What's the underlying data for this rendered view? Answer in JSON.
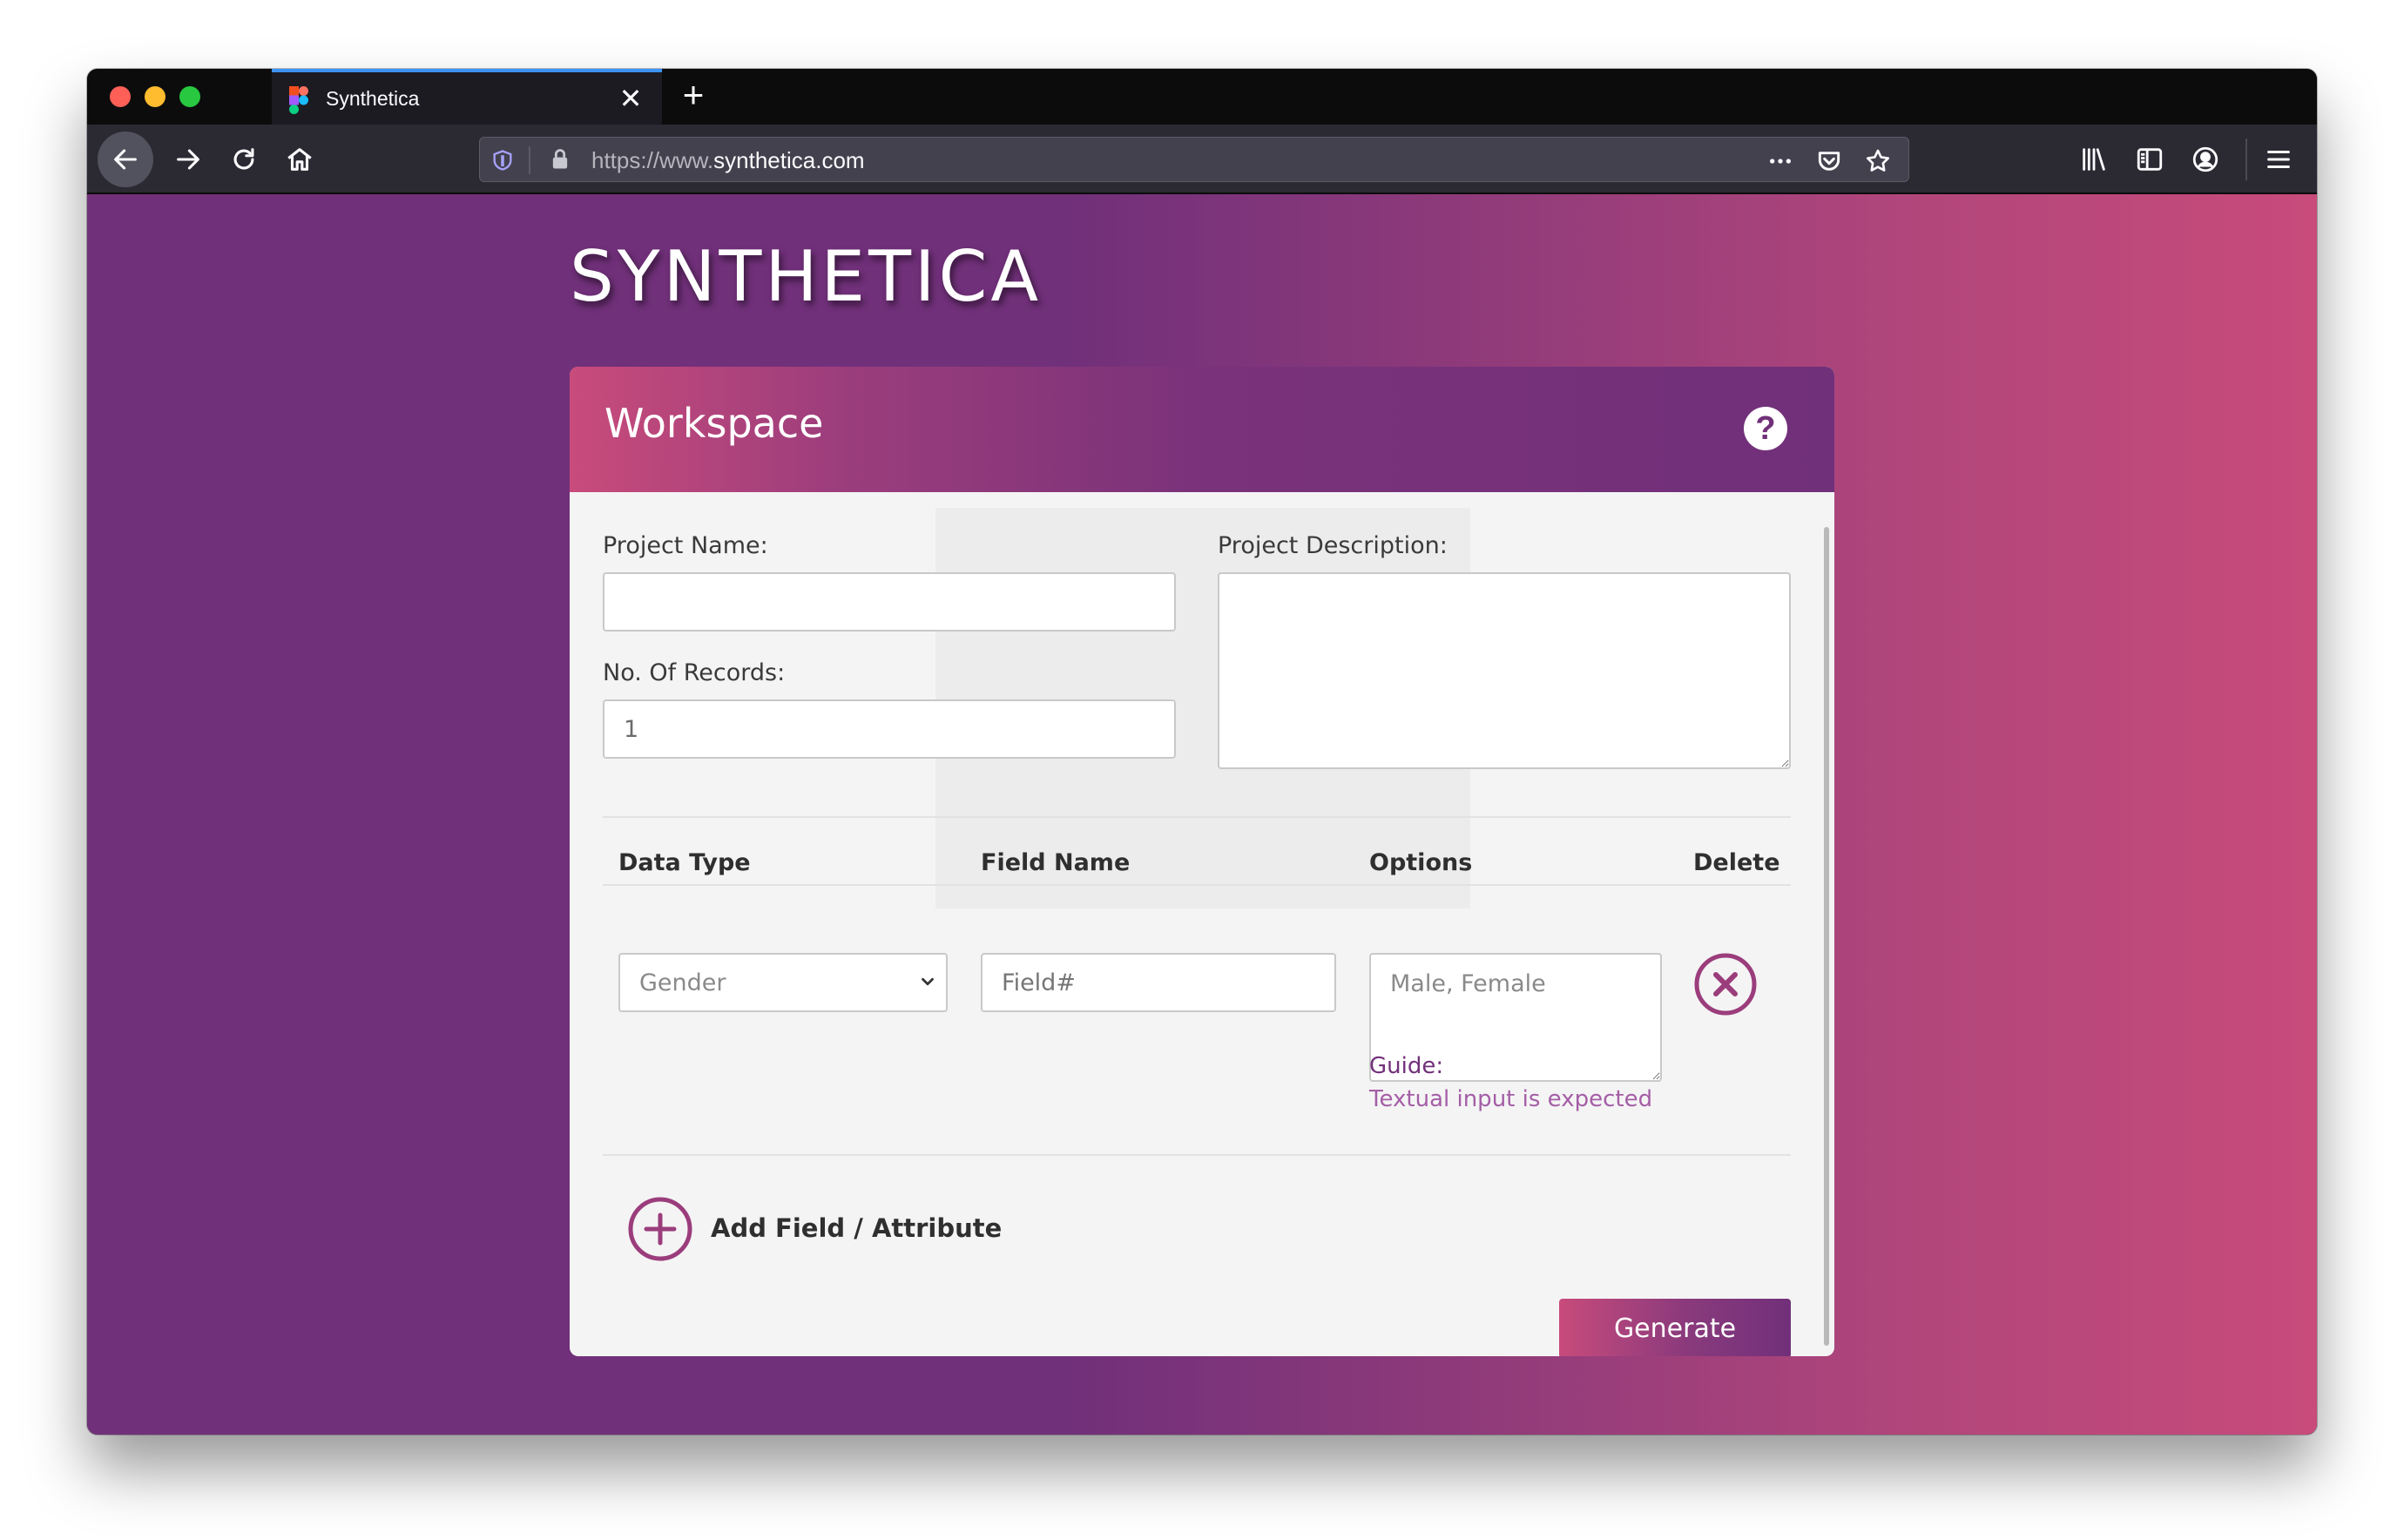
{
  "browser": {
    "tab_title": "Synthetica",
    "url_prefix": "https://www.",
    "url_domain": "synthetica.com",
    "close_symbol": "✕",
    "newtab_symbol": "+"
  },
  "page": {
    "brand": "SYNTHETICA",
    "workspace": {
      "title": "Workspace",
      "help_symbol": "?",
      "project_name_label": "Project Name:",
      "project_name_value": "",
      "project_description_label": "Project Description:",
      "project_description_value": "",
      "records_label": "No. Of Records:",
      "records_value": "1",
      "table": {
        "headers": [
          "Data Type",
          "Field Name",
          "Options",
          "Delete"
        ],
        "rows": [
          {
            "data_type": "Gender",
            "field_name_placeholder": "Field#",
            "options_value": "Male, Female",
            "guide_title": "Guide:",
            "guide_text": "Textual input is expected"
          }
        ]
      },
      "add_field_label": "Add Field / Attribute",
      "generate_label": "Generate"
    }
  },
  "colors": {
    "brand_purple": "#71307a",
    "brand_pink": "#c84b7b"
  }
}
